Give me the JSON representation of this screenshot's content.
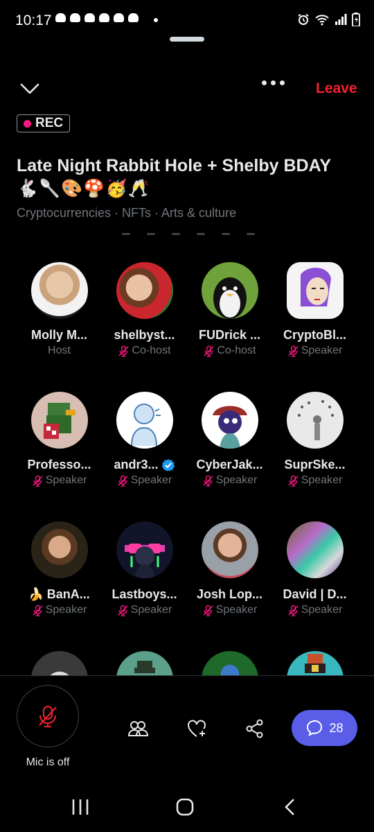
{
  "status_bar": {
    "time": "10:17"
  },
  "header": {
    "leave_label": "Leave",
    "rec_label": "REC"
  },
  "space": {
    "title": "Late Night Rabbit Hole + Shelby BDAY",
    "title_emojis": "🐇🥄🎨🍄🥳🥂",
    "topics": "Cryptocurrencies · NFTs · Arts & culture"
  },
  "participants": [
    {
      "name": "Molly M...",
      "role": "Host",
      "muted": false,
      "verified": false,
      "prefix": ""
    },
    {
      "name": "shelbyst...",
      "role": "Co-host",
      "muted": true,
      "verified": false,
      "prefix": ""
    },
    {
      "name": "FUDrick ...",
      "role": "Co-host",
      "muted": true,
      "verified": false,
      "prefix": ""
    },
    {
      "name": "CryptoBl...",
      "role": "Speaker",
      "muted": true,
      "verified": false,
      "prefix": ""
    },
    {
      "name": "Professo...",
      "role": "Speaker",
      "muted": true,
      "verified": false,
      "prefix": ""
    },
    {
      "name": "andr3...",
      "role": "Speaker",
      "muted": true,
      "verified": true,
      "prefix": ""
    },
    {
      "name": "CyberJak...",
      "role": "Speaker",
      "muted": true,
      "verified": false,
      "prefix": ""
    },
    {
      "name": "SuprSke...",
      "role": "Speaker",
      "muted": true,
      "verified": false,
      "prefix": ""
    },
    {
      "name": "BanA...",
      "role": "Speaker",
      "muted": true,
      "verified": false,
      "prefix": "🍌"
    },
    {
      "name": "Lastboys...",
      "role": "Speaker",
      "muted": true,
      "verified": false,
      "prefix": ""
    },
    {
      "name": "Josh Lop...",
      "role": "Speaker",
      "muted": true,
      "verified": false,
      "prefix": ""
    },
    {
      "name": "David | D...",
      "role": "Speaker",
      "muted": true,
      "verified": false,
      "prefix": ""
    },
    {
      "name": "",
      "role": "",
      "muted": false,
      "verified": false,
      "prefix": ""
    },
    {
      "name": "",
      "role": "",
      "muted": false,
      "verified": false,
      "prefix": ""
    },
    {
      "name": "",
      "role": "",
      "muted": false,
      "verified": false,
      "prefix": ""
    },
    {
      "name": "",
      "role": "",
      "muted": false,
      "verified": false,
      "prefix": ""
    }
  ],
  "bottom_bar": {
    "mic_label": "Mic is off",
    "chat_count": "28"
  },
  "colors": {
    "accent_red": "#f4212e",
    "rec_pink": "#f91880",
    "chat_blue": "#5a5de8",
    "verified_blue": "#1d9bf0",
    "muted_gray": "#71767b"
  }
}
